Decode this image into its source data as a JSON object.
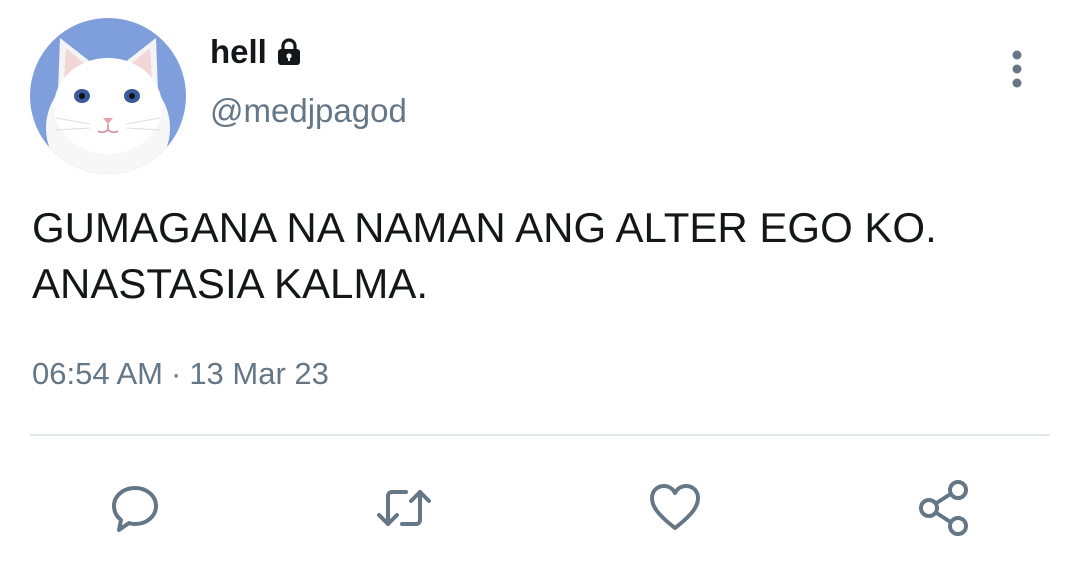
{
  "tweet": {
    "display_name": "hell",
    "handle": "@medjpagod",
    "text": "GUMAGANA NA NAMAN ANG ALTER EGO KO.\nANASTASIA KALMA.",
    "time": "06:54 AM",
    "separator": "·",
    "date": "13 Mar 23",
    "verified_lock": true
  },
  "icons": {
    "avatar": "white-cat-avatar",
    "lock": "lock-icon",
    "more": "more-vertical-icon",
    "reply": "reply-icon",
    "retweet": "retweet-icon",
    "like": "heart-icon",
    "share": "share-icon"
  },
  "colors": {
    "text_primary": "#14171a",
    "text_secondary": "#657786",
    "divider": "#e1e8ed",
    "avatar_bg": "#7f9fdc"
  }
}
